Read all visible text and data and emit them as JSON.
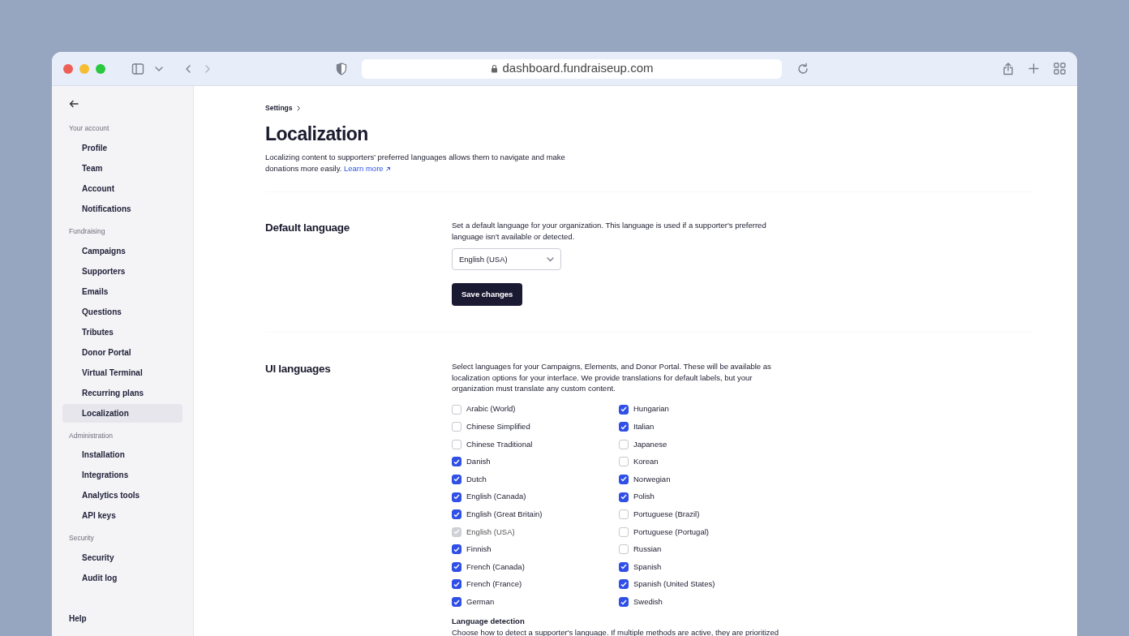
{
  "browser": {
    "url": "dashboard.fundraiseup.com"
  },
  "sidebar": {
    "groups": [
      {
        "heading": "Your account",
        "items": [
          {
            "label": "Profile",
            "selected": false
          },
          {
            "label": "Team",
            "selected": false
          },
          {
            "label": "Account",
            "selected": false
          },
          {
            "label": "Notifications",
            "selected": false
          }
        ]
      },
      {
        "heading": "Fundraising",
        "items": [
          {
            "label": "Campaigns",
            "selected": false
          },
          {
            "label": "Supporters",
            "selected": false
          },
          {
            "label": "Emails",
            "selected": false
          },
          {
            "label": "Questions",
            "selected": false
          },
          {
            "label": "Tributes",
            "selected": false
          },
          {
            "label": "Donor Portal",
            "selected": false
          },
          {
            "label": "Virtual Terminal",
            "selected": false
          },
          {
            "label": "Recurring plans",
            "selected": false
          },
          {
            "label": "Localization",
            "selected": true
          }
        ]
      },
      {
        "heading": "Administration",
        "items": [
          {
            "label": "Installation",
            "selected": false
          },
          {
            "label": "Integrations",
            "selected": false
          },
          {
            "label": "Analytics tools",
            "selected": false
          },
          {
            "label": "API keys",
            "selected": false
          }
        ]
      },
      {
        "heading": "Security",
        "items": [
          {
            "label": "Security",
            "selected": false
          },
          {
            "label": "Audit log",
            "selected": false
          }
        ]
      }
    ],
    "help": "Help"
  },
  "breadcrumb": "Settings",
  "title": "Localization",
  "description": "Localizing content to supporters' preferred languages allows them to navigate and make donations more easily.",
  "learn_more": "Learn more",
  "default_language": {
    "heading": "Default language",
    "text": "Set a default language for your organization. This language is used if a supporter's preferred language isn't available or detected.",
    "value": "English (USA)",
    "button": "Save changes"
  },
  "ui_languages": {
    "heading": "UI languages",
    "text": "Select languages for your Campaigns, Elements, and Donor Portal. These will be available as localization options for your interface. We provide translations for default labels, but your organization must translate any custom content.",
    "languages": [
      {
        "label": "Arabic (World)",
        "checked": false,
        "disabled": false
      },
      {
        "label": "Chinese Simplified",
        "checked": false,
        "disabled": false
      },
      {
        "label": "Chinese Traditional",
        "checked": false,
        "disabled": false
      },
      {
        "label": "Danish",
        "checked": true,
        "disabled": false
      },
      {
        "label": "Dutch",
        "checked": true,
        "disabled": false
      },
      {
        "label": "English (Canada)",
        "checked": true,
        "disabled": false
      },
      {
        "label": "English (Great Britain)",
        "checked": true,
        "disabled": false
      },
      {
        "label": "English (USA)",
        "checked": true,
        "disabled": true
      },
      {
        "label": "Finnish",
        "checked": true,
        "disabled": false
      },
      {
        "label": "French (Canada)",
        "checked": true,
        "disabled": false
      },
      {
        "label": "French (France)",
        "checked": true,
        "disabled": false
      },
      {
        "label": "German",
        "checked": true,
        "disabled": false
      },
      {
        "label": "Hungarian",
        "checked": true,
        "disabled": false
      },
      {
        "label": "Italian",
        "checked": true,
        "disabled": false
      },
      {
        "label": "Japanese",
        "checked": false,
        "disabled": false
      },
      {
        "label": "Korean",
        "checked": false,
        "disabled": false
      },
      {
        "label": "Norwegian",
        "checked": true,
        "disabled": false
      },
      {
        "label": "Polish",
        "checked": true,
        "disabled": false
      },
      {
        "label": "Portuguese (Brazil)",
        "checked": false,
        "disabled": false
      },
      {
        "label": "Portuguese (Portugal)",
        "checked": false,
        "disabled": false
      },
      {
        "label": "Russian",
        "checked": false,
        "disabled": false
      },
      {
        "label": "Spanish",
        "checked": true,
        "disabled": false
      },
      {
        "label": "Spanish (United States)",
        "checked": true,
        "disabled": false
      },
      {
        "label": "Swedish",
        "checked": true,
        "disabled": false
      }
    ],
    "detection_heading": "Language detection",
    "detection_text": "Choose how to detect a supporter's language. If multiple methods are active, they are prioritized"
  }
}
